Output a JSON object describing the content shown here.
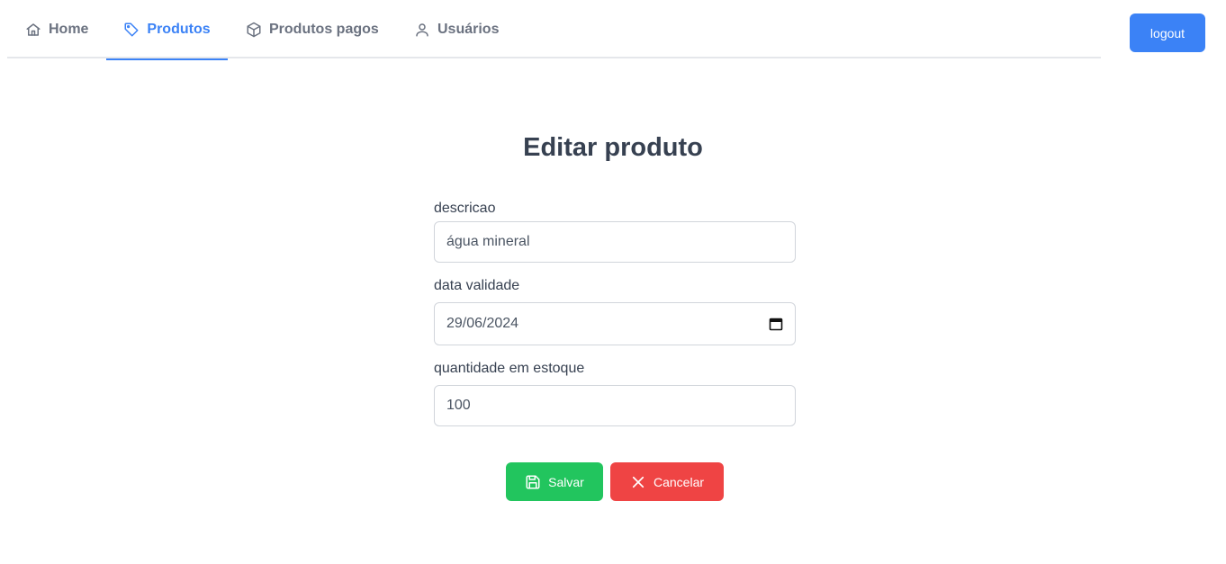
{
  "nav": {
    "tabs": [
      {
        "label": "Home",
        "icon": "home-icon"
      },
      {
        "label": "Produtos",
        "icon": "tag-icon",
        "active": true
      },
      {
        "label": "Produtos pagos",
        "icon": "box-icon"
      },
      {
        "label": "Usuários",
        "icon": "user-icon"
      }
    ],
    "logout_label": "logout"
  },
  "form": {
    "title": "Editar produto",
    "fields": {
      "descricao": {
        "label": "descricao",
        "value": "água mineral"
      },
      "data_validade": {
        "label": "data validade",
        "value": "29/06/2024",
        "icon": "calendar-icon"
      },
      "quantidade": {
        "label": "quantidade em estoque",
        "value": "100"
      }
    },
    "save_label": "Salvar",
    "save_icon": "save-icon",
    "cancel_label": "Cancelar",
    "cancel_icon": "close-icon"
  },
  "colors": {
    "primary": "#3b82f6",
    "success": "#22c55e",
    "danger": "#ef4444"
  }
}
